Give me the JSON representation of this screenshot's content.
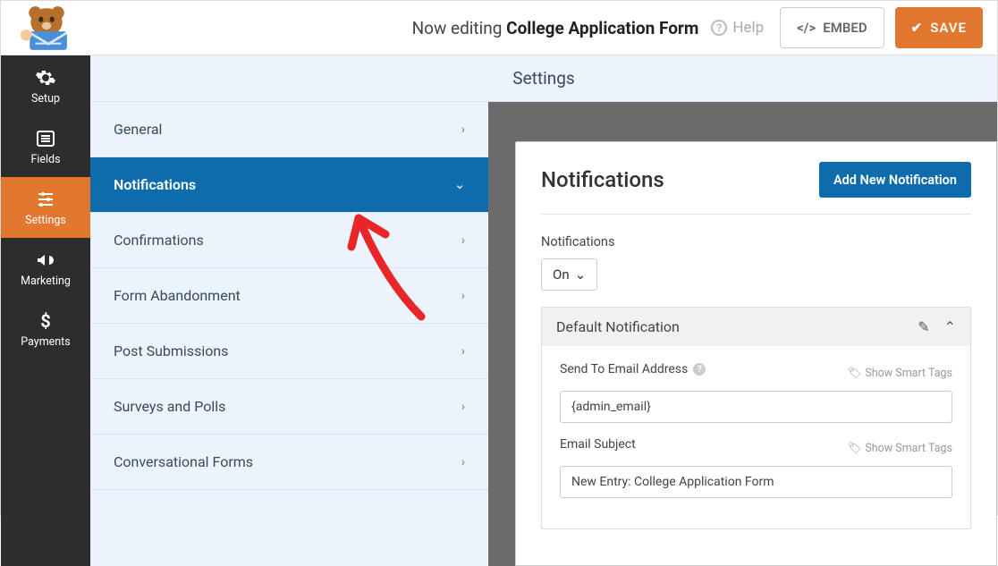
{
  "topbar": {
    "editing_prefix": "Now editing ",
    "form_title": "College Application Form",
    "help_label": "Help",
    "embed_label": "EMBED",
    "save_label": "SAVE"
  },
  "sidebar": {
    "items": [
      {
        "label": "Setup"
      },
      {
        "label": "Fields"
      },
      {
        "label": "Settings"
      },
      {
        "label": "Marketing"
      },
      {
        "label": "Payments"
      }
    ]
  },
  "page_title": "Settings",
  "subnav": {
    "items": [
      {
        "label": "General"
      },
      {
        "label": "Notifications"
      },
      {
        "label": "Confirmations"
      },
      {
        "label": "Form Abandonment"
      },
      {
        "label": "Post Submissions"
      },
      {
        "label": "Surveys and Polls"
      },
      {
        "label": "Conversational Forms"
      }
    ]
  },
  "panel": {
    "title": "Notifications",
    "add_button": "Add New Notification",
    "toggle_label": "Notifications",
    "toggle_value": "On",
    "row": {
      "title": "Default Notification",
      "send_to_label": "Send To Email Address",
      "send_to_value": "{admin_email}",
      "subject_label": "Email Subject",
      "subject_value": "New Entry: College Application Form",
      "smart_tags": "Show Smart Tags"
    }
  }
}
